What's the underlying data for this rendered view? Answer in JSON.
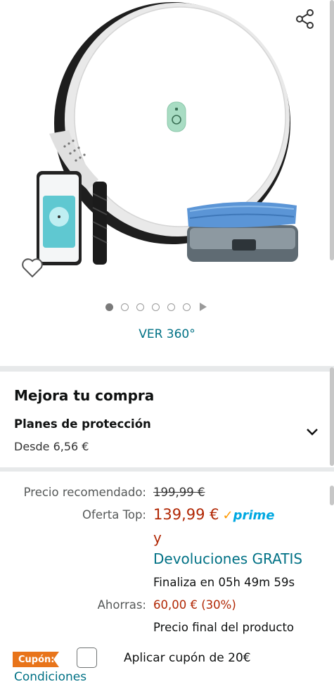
{
  "gallery": {
    "view360_label": "VER 360°",
    "dots_count": 6,
    "active_dot": 1
  },
  "upsell": {
    "title": "Mejora tu compra",
    "plan_title": "Planes de protección",
    "plan_price": "Desde 6,56 €"
  },
  "pricing": {
    "recommended_label": "Precio recomendado:",
    "recommended_value": "199,99 €",
    "deal_label": "Oferta Top:",
    "deal_value": "139,99 €",
    "prime_check": "✓",
    "prime_word": "prime",
    "and_text": "y",
    "returns_text": "Devoluciones GRATIS",
    "countdown": "Finaliza en 05h 49m 59s",
    "savings_label": "Ahorras:",
    "savings_value": "60,00 € (30%)",
    "final_price_note": "Precio final del producto"
  },
  "coupon": {
    "badge": "Cupón:",
    "text": "Aplicar cupón de 20€",
    "conditions": "Condiciones"
  },
  "colors": {
    "link": "#007185",
    "price_red": "#B12704",
    "coupon_orange": "#E8741A",
    "prime_blue": "#00A8E1"
  }
}
